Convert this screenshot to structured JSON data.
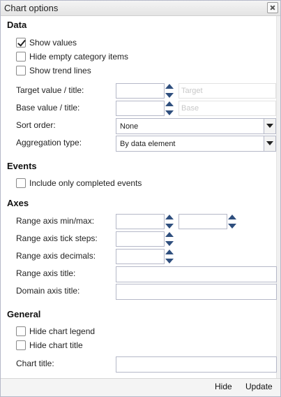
{
  "window": {
    "title": "Chart options",
    "close_icon": "close-icon"
  },
  "sections": {
    "data": {
      "heading": "Data",
      "show_values": {
        "label": "Show values",
        "checked": true
      },
      "hide_empty": {
        "label": "Hide empty category items",
        "checked": false
      },
      "show_trend": {
        "label": "Show trend lines",
        "checked": false
      },
      "target_label": "Target value / title:",
      "target_placeholder": "Target",
      "base_label": "Base value / title:",
      "base_placeholder": "Base",
      "sort_label": "Sort order:",
      "sort_value": "None",
      "aggregation_label": "Aggregation type:",
      "aggregation_value": "By data element"
    },
    "events": {
      "heading": "Events",
      "completed_only": {
        "label": "Include only completed events",
        "checked": false
      }
    },
    "axes": {
      "heading": "Axes",
      "range_minmax_label": "Range axis min/max:",
      "tick_steps_label": "Range axis tick steps:",
      "decimals_label": "Range axis decimals:",
      "range_title_label": "Range axis title:",
      "domain_title_label": "Domain axis title:"
    },
    "general": {
      "heading": "General",
      "hide_legend": {
        "label": "Hide chart legend",
        "checked": false
      },
      "hide_title": {
        "label": "Hide chart title",
        "checked": false
      },
      "chart_title_label": "Chart title:"
    }
  },
  "footer": {
    "hide_label": "Hide",
    "update_label": "Update"
  },
  "colors": {
    "spinner_arrow": "#2f4f7e",
    "border": "#b5b8c8"
  }
}
